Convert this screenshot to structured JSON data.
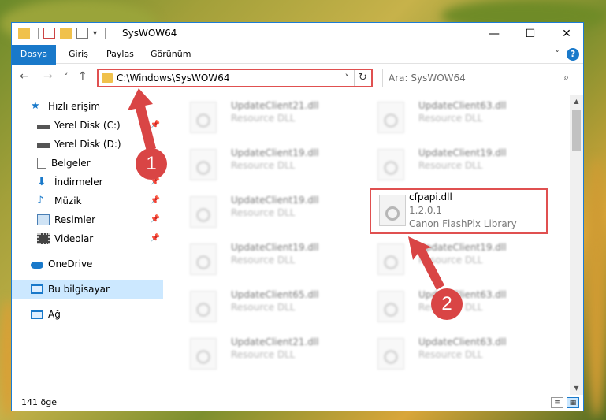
{
  "window": {
    "title": "SysWOW64",
    "controls": {
      "minimize": "—",
      "maximize": "☐",
      "close": "✕"
    }
  },
  "ribbon": {
    "tabs": [
      "Dosya",
      "Giriş",
      "Paylaş",
      "Görünüm"
    ],
    "help": "?"
  },
  "navigation": {
    "back": "←",
    "forward": "→",
    "recent": "˅",
    "up": "↑",
    "address_path": "C:\\Windows\\SysWOW64",
    "refresh": "↻",
    "search_placeholder": "Ara: SysWOW64"
  },
  "sidebar": {
    "items": [
      {
        "label": "Hızlı erişim",
        "icon": "star-icon"
      },
      {
        "label": "Yerel Disk (C:)",
        "icon": "drive-icon"
      },
      {
        "label": "Yerel Disk (D:)",
        "icon": "drive-icon"
      },
      {
        "label": "Belgeler",
        "icon": "documents-icon"
      },
      {
        "label": "İndirmeler",
        "icon": "download-icon"
      },
      {
        "label": "Müzik",
        "icon": "music-icon"
      },
      {
        "label": "Resimler",
        "icon": "pictures-icon"
      },
      {
        "label": "Videolar",
        "icon": "video-icon"
      },
      {
        "label": "OneDrive",
        "icon": "cloud-icon"
      },
      {
        "label": "Bu bilgisayar",
        "icon": "computer-icon"
      },
      {
        "label": "Ağ",
        "icon": "network-icon"
      }
    ]
  },
  "files": [
    {
      "name": "UpdateClient21.dll",
      "type": "Resource DLL"
    },
    {
      "name": "UpdateClient63.dll",
      "type": "Resource DLL"
    },
    {
      "name": "UpdateClient19.dll",
      "type": "Resource DLL"
    },
    {
      "name": "UpdateClient19.dll",
      "type": "Resource DLL"
    },
    {
      "name": "UpdateClient19.dll",
      "type": "Resource DLL"
    },
    {
      "name": "cfpapi.dll",
      "version": "1.2.0.1",
      "description": "Canon FlashPix Library"
    },
    {
      "name": "UpdateClient19.dll",
      "type": "Resource DLL"
    },
    {
      "name": "UpdateClient19.dll",
      "type": "Resource DLL"
    },
    {
      "name": "UpdateClient65.dll",
      "type": "Resource DLL"
    },
    {
      "name": "UpdateClient63.dll",
      "type": "Resource DLL"
    },
    {
      "name": "UpdateClient21.dll",
      "type": "Resource DLL"
    },
    {
      "name": "UpdateClient63.dll",
      "type": "Resource DLL"
    }
  ],
  "status": {
    "item_count": "141 öge"
  },
  "callouts": {
    "one": "1",
    "two": "2"
  },
  "colors": {
    "accent": "#1979ca",
    "highlight": "#e05050"
  }
}
